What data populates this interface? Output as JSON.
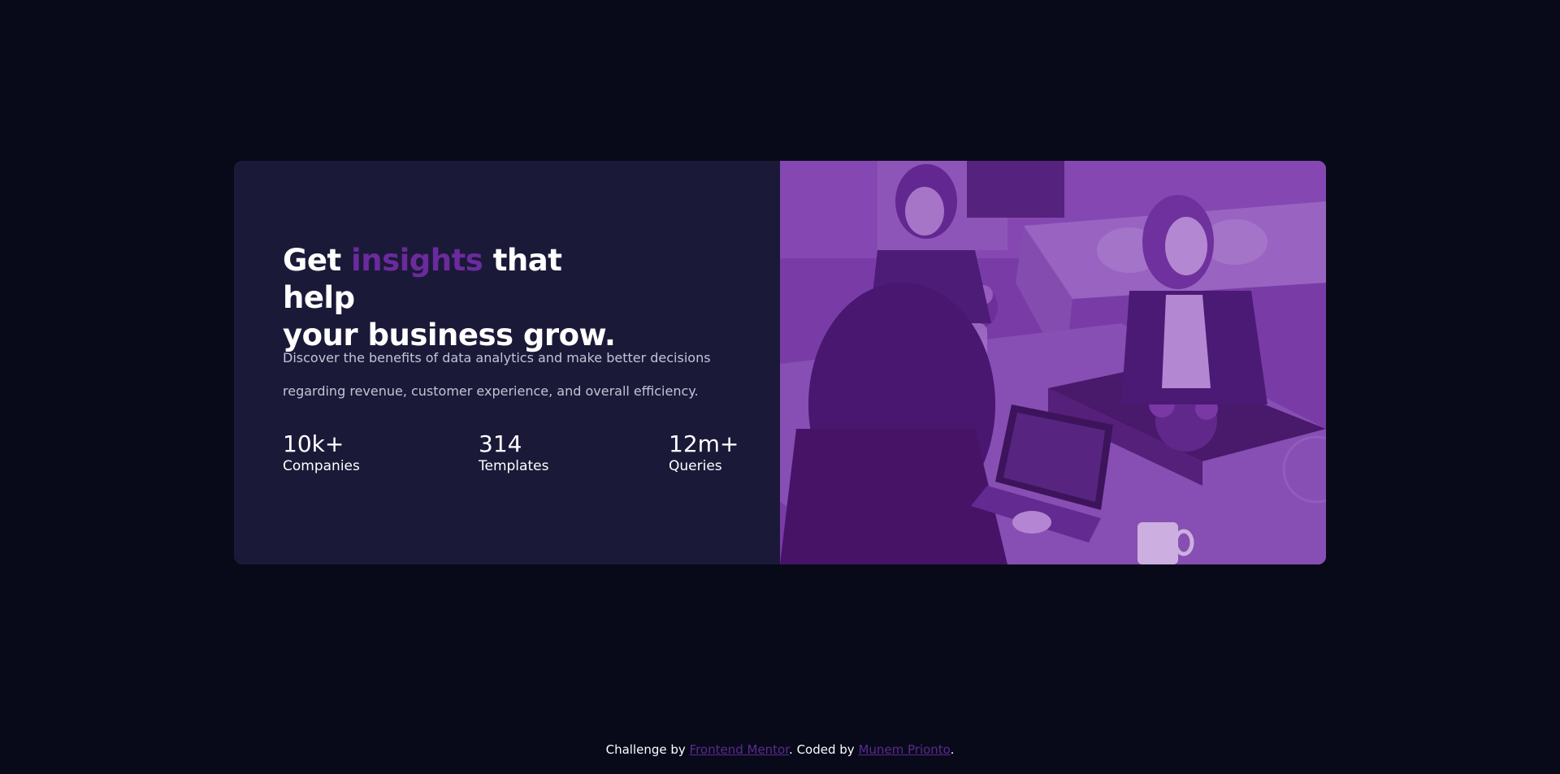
{
  "card": {
    "headline": {
      "part1": "Get ",
      "accent": "insights",
      "part2": " that help",
      "line2": "your business grow."
    },
    "description": "Discover the benefits of data analytics and make better decisions regarding revenue, customer experience, and overall efficiency.",
    "stats": [
      {
        "value": "10k+",
        "label": "Companies"
      },
      {
        "value": "314",
        "label": "Templates"
      },
      {
        "value": "12m+",
        "label": "Queries"
      }
    ],
    "image": {
      "icon": "team-working-photo"
    }
  },
  "attribution": {
    "prefix": "Challenge by ",
    "challenge_link": "Frontend Mentor",
    "middle": ". Coded by ",
    "author_link": "Munem Prionto",
    "suffix": "."
  },
  "colors": {
    "page_background": "#080a1a",
    "card_background": "#1b1938",
    "accent": "#6b2a9e",
    "image_tint": "#6a2f98"
  }
}
